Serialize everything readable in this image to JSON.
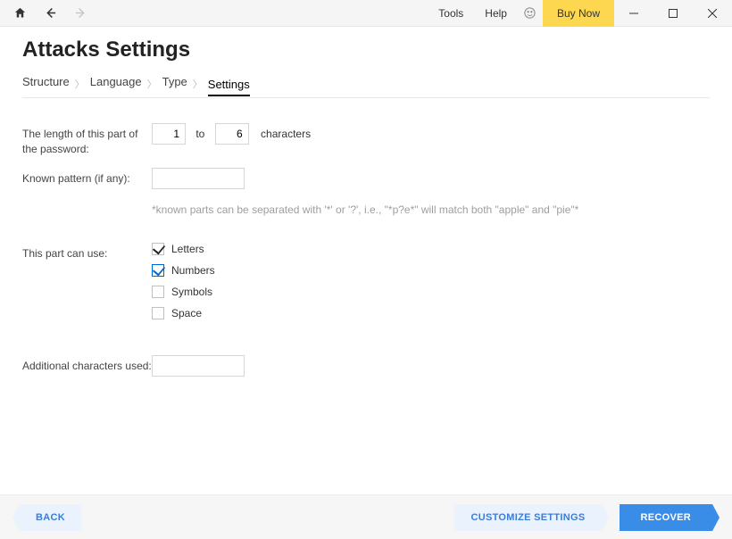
{
  "titlebar": {
    "tools": "Tools",
    "help": "Help",
    "buy": "Buy Now"
  },
  "page_title": "Attacks Settings",
  "breadcrumb": {
    "items": [
      "Structure",
      "Language",
      "Type",
      "Settings"
    ],
    "active_index": 3
  },
  "form": {
    "length_label": "The length of this part of the password:",
    "length_from": "1",
    "length_between": "to",
    "length_to": "6",
    "length_after": "characters",
    "pattern_label": "Known pattern (if any):",
    "pattern_value": "",
    "pattern_hint": "*known parts can be separated with '*' or '?', i.e., \"*p?e*\" will match both \"apple\" and \"pie\"*",
    "use_label": "This part can use:",
    "checkboxes": [
      {
        "label": "Letters",
        "checked": true,
        "blue": false
      },
      {
        "label": "Numbers",
        "checked": true,
        "blue": true
      },
      {
        "label": "Symbols",
        "checked": false,
        "blue": false
      },
      {
        "label": "Space",
        "checked": false,
        "blue": false
      }
    ],
    "additional_label": "Additional characters used:",
    "additional_value": ""
  },
  "footer": {
    "back": "BACK",
    "customize": "CUSTOMIZE SETTINGS",
    "recover": "RECOVER"
  }
}
